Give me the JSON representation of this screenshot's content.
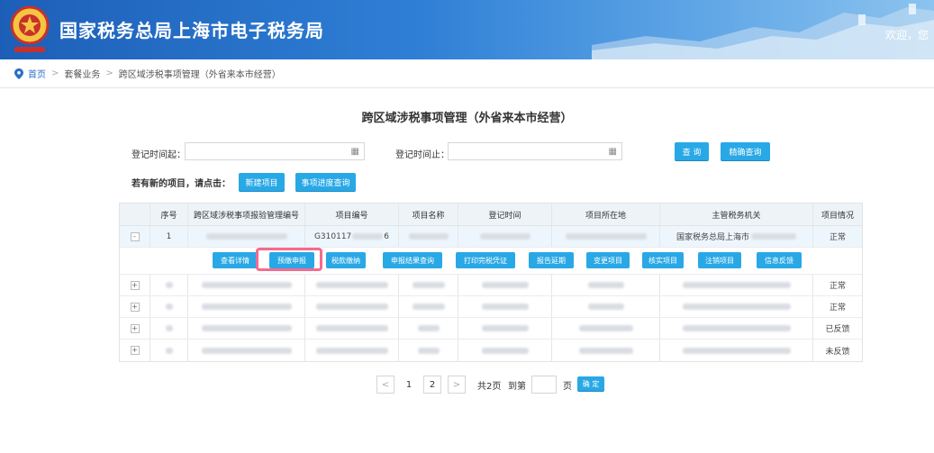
{
  "header": {
    "site_title": "国家税务总局上海市电子税务局",
    "welcome": "欢迎，您"
  },
  "breadcrumb": {
    "home": "首页",
    "level1": "套餐业务",
    "level2": "跨区域涉税事项管理（外省来本市经营）"
  },
  "page_title": "跨区域涉税事项管理（外省来本市经营）",
  "search": {
    "start_label": "登记时间起：",
    "end_label": "登记时间止：",
    "query_button": "查 询",
    "precise_query_button": "精确查询"
  },
  "hint": {
    "text": "若有新的项目，请点击：",
    "new_project_button": "新建项目",
    "progress_query_button": "事项进度查询"
  },
  "table": {
    "headers": [
      "序号",
      "跨区域涉税事项报验管理编号",
      "项目编号",
      "项目名称",
      "登记时间",
      "项目所在地",
      "主管税务机关",
      "项目情况"
    ],
    "expanded_row": {
      "expander": "-",
      "index": "1",
      "project_no": "G310117",
      "project_no_tail": "6",
      "tax_authority": "国家税务总局上海市",
      "status": "正常"
    },
    "actions": [
      "查看详情",
      "预缴申报",
      "税款缴纳",
      "申报结果查询",
      "打印完税凭证",
      "报告延期",
      "变更项目",
      "核实项目",
      "注销项目",
      "信息反馈"
    ],
    "other_rows": [
      {
        "expander": "+",
        "status": "正常"
      },
      {
        "expander": "+",
        "status": "正常"
      },
      {
        "expander": "+",
        "status": "已反馈"
      },
      {
        "expander": "+",
        "status": "未反馈"
      }
    ]
  },
  "pagination": {
    "prev": "<",
    "page1": "1",
    "page2": "2",
    "next": ">",
    "total": "共2页",
    "goto": "到第",
    "page_unit": "页",
    "confirm": "确 定"
  },
  "colors": {
    "header_blue": "#1d5fb8",
    "button_blue": "#29a8e6",
    "highlight": "#f46a8f"
  }
}
